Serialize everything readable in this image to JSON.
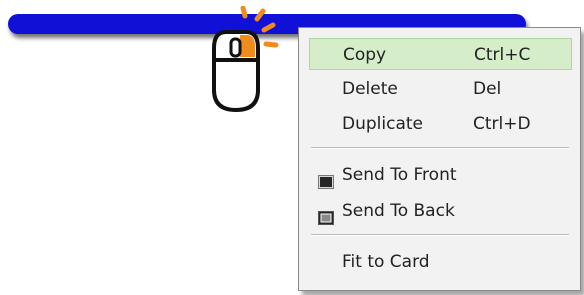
{
  "canvas": {
    "shape_color": "#1010d6",
    "accent_color": "#f08c1e"
  },
  "cursor": {
    "icon": "mouse-right-click-icon"
  },
  "context_menu": {
    "items": [
      {
        "label": "Copy",
        "shortcut": "Ctrl+C",
        "highlighted": true
      },
      {
        "label": "Delete",
        "shortcut": "Del"
      },
      {
        "label": "Duplicate",
        "shortcut": "Ctrl+D"
      },
      {
        "label": "Send To Front",
        "icon": "send-to-front-icon"
      },
      {
        "label": "Send To Back",
        "icon": "send-to-back-icon"
      },
      {
        "label": "Fit to Card"
      }
    ],
    "highlight_color": "#d5edc8"
  }
}
